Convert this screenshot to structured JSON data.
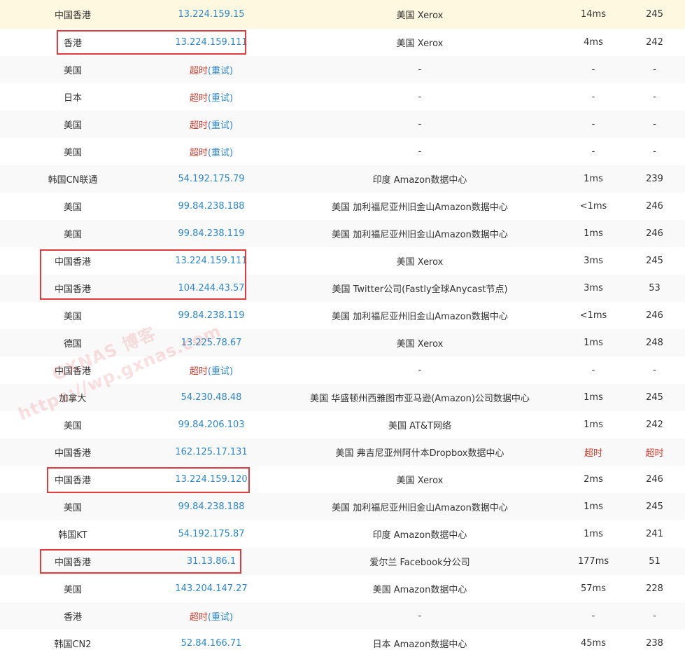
{
  "rows": [
    {
      "loc": "中国香港",
      "ip": "13.224.159.15",
      "dest": "美国 Xerox",
      "ms": "14ms",
      "ttl": "245"
    },
    {
      "loc": "香港",
      "ip": "13.224.159.111",
      "dest": "美国 Xerox",
      "ms": "4ms",
      "ttl": "242"
    },
    {
      "loc": "美国",
      "timeout": true,
      "dest": "-",
      "ms": "-",
      "ttl": "-"
    },
    {
      "loc": "日本",
      "timeout": true,
      "dest": "-",
      "ms": "-",
      "ttl": "-"
    },
    {
      "loc": "美国",
      "timeout": true,
      "dest": "-",
      "ms": "-",
      "ttl": "-"
    },
    {
      "loc": "美国",
      "timeout": true,
      "dest": "-",
      "ms": "-",
      "ttl": "-"
    },
    {
      "loc": "韩国CN联通",
      "ip": "54.192.175.79",
      "dest": "印度 Amazon数据中心",
      "ms": "1ms",
      "ttl": "239"
    },
    {
      "loc": "美国",
      "ip": "99.84.238.188",
      "dest": "美国 加利福尼亚州旧金山Amazon数据中心",
      "ms": "<1ms",
      "ttl": "246"
    },
    {
      "loc": "美国",
      "ip": "99.84.238.119",
      "dest": "美国 加利福尼亚州旧金山Amazon数据中心",
      "ms": "1ms",
      "ttl": "246"
    },
    {
      "loc": "中国香港",
      "ip": "13.224.159.111",
      "dest": "美国 Xerox",
      "ms": "3ms",
      "ttl": "245"
    },
    {
      "loc": "中国香港",
      "ip": "104.244.43.57",
      "dest": "美国 Twitter公司(Fastly全球Anycast节点)",
      "ms": "3ms",
      "ttl": "53"
    },
    {
      "loc": "美国",
      "ip": "99.84.238.119",
      "dest": "美国 加利福尼亚州旧金山Amazon数据中心",
      "ms": "<1ms",
      "ttl": "246"
    },
    {
      "loc": "德国",
      "ip": "13.225.78.67",
      "dest": "美国 Xerox",
      "ms": "1ms",
      "ttl": "248"
    },
    {
      "loc": "中国香港",
      "timeout": true,
      "dest": "-",
      "ms": "-",
      "ttl": "-"
    },
    {
      "loc": "加拿大",
      "ip": "54.230.48.48",
      "dest": "美国 华盛顿州西雅图市亚马逊(Amazon)公司数据中心",
      "ms": "1ms",
      "ttl": "245"
    },
    {
      "loc": "美国",
      "ip": "99.84.206.103",
      "dest": "美国 AT&T网络",
      "ms": "1ms",
      "ttl": "242"
    },
    {
      "loc": "中国香港",
      "ip": "162.125.17.131",
      "dest": "美国 弗吉尼亚州阿什本Dropbox数据中心",
      "ms": "超时",
      "ttl": "超时",
      "ms_timeout": true
    },
    {
      "loc": "中国香港",
      "ip": "13.224.159.120",
      "dest": "美国 Xerox",
      "ms": "2ms",
      "ttl": "246"
    },
    {
      "loc": "美国",
      "ip": "99.84.238.188",
      "dest": "美国 加利福尼亚州旧金山Amazon数据中心",
      "ms": "1ms",
      "ttl": "245"
    },
    {
      "loc": "韩国KT",
      "ip": "54.192.175.87",
      "dest": "印度 Amazon数据中心",
      "ms": "1ms",
      "ttl": "241"
    },
    {
      "loc": "中国香港",
      "ip": "31.13.86.1",
      "dest": "爱尔兰 Facebook分公司",
      "ms": "177ms",
      "ttl": "51"
    },
    {
      "loc": "美国",
      "ip": "143.204.147.27",
      "dest": "美国 Amazon数据中心",
      "ms": "57ms",
      "ttl": "228"
    },
    {
      "loc": "香港",
      "timeout": true,
      "dest": "-",
      "ms": "-",
      "ttl": "-"
    },
    {
      "loc": "韩国CN2",
      "ip": "52.84.166.71",
      "dest": "日本 Amazon数据中心",
      "ms": "45ms",
      "ttl": "238"
    }
  ],
  "labels": {
    "timeout": "超时",
    "retry": "重试"
  },
  "watermark": {
    "line1": "GXNAS 博客",
    "line2": "https://wp.gxnas.com"
  },
  "colors": {
    "link": "#2d87c8",
    "timeout": "#d63c2f",
    "highlight_box": "#e33b3b",
    "row_highlight": "#fdf8df"
  }
}
